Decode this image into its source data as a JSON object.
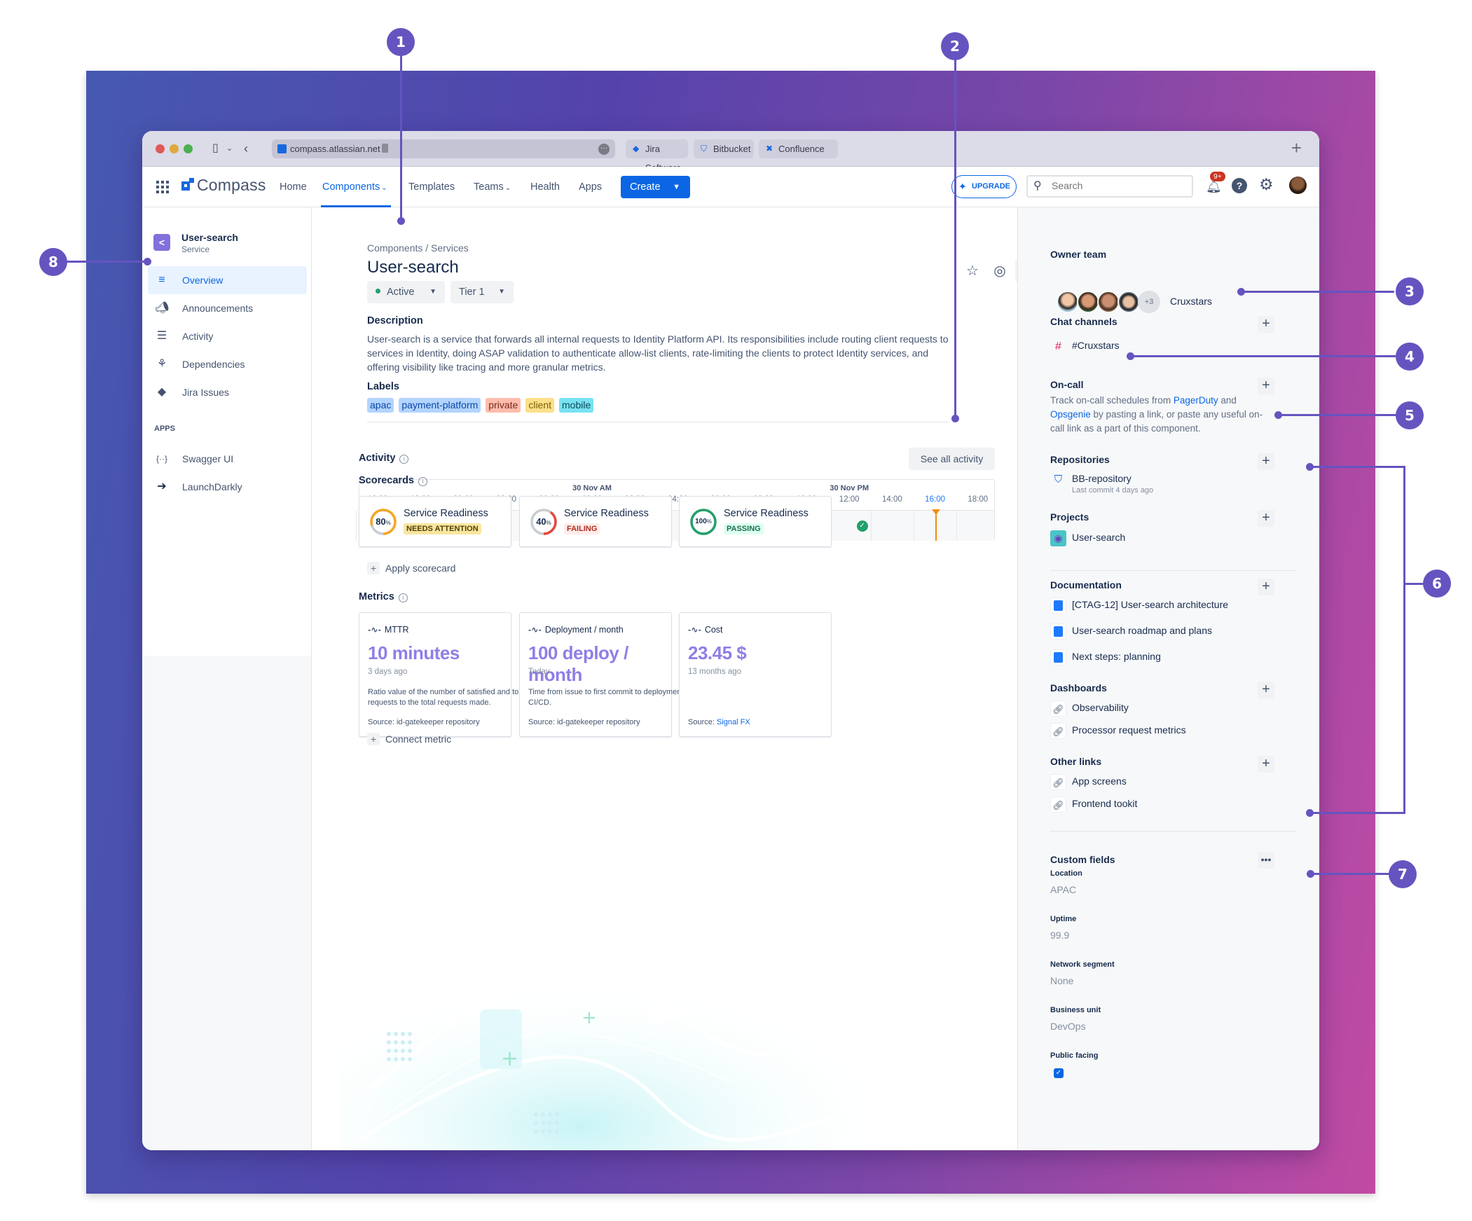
{
  "browser": {
    "url": "compass.atlassian.net",
    "tabs": [
      {
        "label": "Jira Software",
        "icon": "jira-icon"
      },
      {
        "label": "Bitbucket",
        "icon": "bitbucket-icon"
      },
      {
        "label": "Confluence",
        "icon": "confluence-icon"
      }
    ],
    "new_tab": "+"
  },
  "nav": {
    "product": "Compass",
    "links": [
      {
        "label": "Home",
        "active": false,
        "dropdown": false
      },
      {
        "label": "Components",
        "active": true,
        "dropdown": true
      },
      {
        "label": "Templates",
        "active": false,
        "dropdown": false
      },
      {
        "label": "Teams",
        "active": false,
        "dropdown": true
      },
      {
        "label": "Health",
        "active": false,
        "dropdown": false
      },
      {
        "label": "Apps",
        "active": false,
        "dropdown": false
      }
    ],
    "create_label": "Create",
    "upgrade_label": "UPGRADE",
    "search_placeholder": "Search",
    "notifications_badge": "9+",
    "help_glyph": "?"
  },
  "sidebar": {
    "component_name": "User-search",
    "component_type": "Service",
    "items": [
      {
        "label": "Overview",
        "icon": "overview-icon",
        "active": true
      },
      {
        "label": "Announcements",
        "icon": "megaphone-icon",
        "active": false
      },
      {
        "label": "Activity",
        "icon": "activity-icon",
        "active": false
      },
      {
        "label": "Dependencies",
        "icon": "dependencies-icon",
        "active": false
      },
      {
        "label": "Jira Issues",
        "icon": "jira-icon",
        "active": false
      }
    ],
    "apps_heading": "APPS",
    "apps": [
      {
        "label": "Swagger UI",
        "icon": "swagger-icon",
        "glyph": "{··}"
      },
      {
        "label": "LaunchDarkly",
        "icon": "launchdarkly-icon",
        "glyph": "➔"
      }
    ]
  },
  "main": {
    "breadcrumb": "Components  /  Services",
    "title": "User-search",
    "status": "Active",
    "tier": "Tier 1",
    "description_heading": "Description",
    "description": "User-search is a service that forwards all internal requests to Identity Platform API. Its responsibilities include routing client requests to services in Identity, doing ASAP validation to authenticate allow-list clients, rate-limiting the clients to protect Identity services, and offering visibility like tracing and more granular metrics.",
    "labels_heading": "Labels",
    "labels": [
      {
        "text": "apac",
        "bg": "#b3d4ff",
        "fg": "#0747a6"
      },
      {
        "text": "payment-platform",
        "bg": "#b3d4ff",
        "fg": "#0747a6"
      },
      {
        "text": "private",
        "bg": "#ffbdad",
        "fg": "#7a2a1a"
      },
      {
        "text": "client",
        "bg": "#fce08a",
        "fg": "#7f5f01"
      },
      {
        "text": "mobile",
        "bg": "#79e2f2",
        "fg": "#0a4b58"
      }
    ],
    "activity": {
      "heading": "Activity",
      "see_all": "See all activity",
      "dates": [
        {
          "label": "30 Nov AM",
          "at_tick": 5
        },
        {
          "label": "30 Nov PM",
          "at_tick": 11
        }
      ],
      "ticks": [
        "16:00",
        "18:00",
        "20:00",
        "22:00",
        "00:00",
        "00:00",
        "02:00",
        "04:00",
        "06:00",
        "08:00",
        "10:00",
        "12:00",
        "14:00",
        "16:00",
        "18:00"
      ],
      "current_tick_index": 13,
      "events": [
        {
          "type": "deployment-rollback",
          "at_tick": 1.1,
          "color": "#f18d13",
          "glyph": "↺"
        },
        {
          "type": "deployment-success",
          "at_tick": 4.15,
          "color": "#22a06b",
          "glyph": "✓"
        },
        {
          "type": "scheduled",
          "at_tick": 8.1,
          "color": "#0c66e4",
          "glyph": "◷"
        },
        {
          "type": "deployment-success",
          "at_tick": 11.3,
          "color": "#22a06b",
          "glyph": "✓"
        }
      ]
    },
    "scorecards": {
      "heading": "Scorecards",
      "items": [
        {
          "name": "Service Readiness",
          "score": 80,
          "status": "NEEDS ATTENTION",
          "ring": "#f5a623",
          "loz_bg": "#f8e6a0",
          "loz_fg": "#533f04"
        },
        {
          "name": "Service Readiness",
          "score": 40,
          "status": "FAILING",
          "ring": "#e2483d",
          "loz_bg": "#ffecea",
          "loz_fg": "#ae2e24"
        },
        {
          "name": "Service Readiness",
          "score": 100,
          "status": "PASSING",
          "ring": "#22a06b",
          "loz_bg": "#dcfff1",
          "loz_fg": "#216e4e"
        }
      ],
      "apply_label": "Apply scorecard"
    },
    "metrics": {
      "heading": "Metrics",
      "items": [
        {
          "name": "MTTR",
          "value": "10 minutes",
          "when": "3 days ago",
          "desc": "Ratio value of the number of satisfied and tolerating requests to the total requests made.",
          "source_prefix": "Source: ",
          "source": "id-gatekeeper repository",
          "source_link": false
        },
        {
          "name": "Deployment / month",
          "value": "100 deploy / month",
          "when": "Today",
          "desc": "Time from issue to first commit to deployment based on CI/CD.",
          "source_prefix": "Source: ",
          "source": "id-gatekeeper repository",
          "source_link": false
        },
        {
          "name": "Cost",
          "value": "23.45 $",
          "when": "13 months ago",
          "desc": "",
          "source_prefix": "Source: ",
          "source": "Signal FX",
          "source_link": true
        }
      ],
      "connect_label": "Connect metric"
    }
  },
  "right": {
    "owner_heading": "Owner team",
    "owner_more": "+3",
    "owner_team": "Cruxstars",
    "chat_heading": "Chat channels",
    "chat_channel": "#Cruxstars",
    "oncall_heading": "On-call",
    "oncall_text_1": "Track on-call schedules from ",
    "oncall_link_1": "PagerDuty",
    "oncall_text_2": " and ",
    "oncall_link_2": "Opsgenie",
    "oncall_text_3": " by pasting a link, or paste any useful on-call link as a part of this component.",
    "repos_heading": "Repositories",
    "repo_name": "BB-repository",
    "repo_sub": "Last commit 4 days ago",
    "projects_heading": "Projects",
    "project_name": "User-search",
    "docs_heading": "Documentation",
    "docs": [
      "[CTAG-12] User-search architecture",
      "User-search roadmap and plans",
      "Next steps: planning"
    ],
    "dash_heading": "Dashboards",
    "dashboards": [
      "Observability",
      "Processor request metrics"
    ],
    "other_heading": "Other links",
    "other_links": [
      "App screens",
      "Frontend tookit"
    ],
    "custom_heading": "Custom fields",
    "custom_fields": [
      {
        "label": "Location",
        "value": "APAC"
      },
      {
        "label": "Uptime",
        "value": "99.9"
      },
      {
        "label": "Network segment",
        "value": "None"
      },
      {
        "label": "Business unit",
        "value": "DevOps"
      },
      {
        "label": "Public facing",
        "value": "checked"
      }
    ]
  },
  "callouts": [
    "1",
    "2",
    "3",
    "4",
    "5",
    "6",
    "7",
    "8"
  ]
}
